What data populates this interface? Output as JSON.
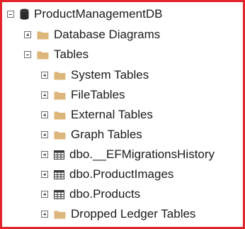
{
  "tree": {
    "root": {
      "label": "ProductManagementDB",
      "state": "expanded",
      "icon": "database-icon"
    },
    "nodes": [
      {
        "label": "Database Diagrams",
        "state": "collapsed",
        "icon": "folder-icon"
      },
      {
        "label": "Tables",
        "state": "expanded",
        "icon": "folder-icon"
      },
      {
        "label": "System Tables",
        "state": "collapsed",
        "icon": "folder-icon"
      },
      {
        "label": "FileTables",
        "state": "collapsed",
        "icon": "folder-icon"
      },
      {
        "label": "External Tables",
        "state": "collapsed",
        "icon": "folder-icon"
      },
      {
        "label": "Graph Tables",
        "state": "collapsed",
        "icon": "folder-icon"
      },
      {
        "label": "dbo.__EFMigrationsHistory",
        "state": "collapsed",
        "icon": "table-icon"
      },
      {
        "label": "dbo.ProductImages",
        "state": "collapsed",
        "icon": "table-icon"
      },
      {
        "label": "dbo.Products",
        "state": "collapsed",
        "icon": "table-icon"
      },
      {
        "label": "Dropped Ledger Tables",
        "state": "collapsed",
        "icon": "folder-icon"
      }
    ]
  },
  "colors": {
    "frame": "#e3242b",
    "folder": "#dcb67a",
    "database": "#2b2b2b",
    "table": "#3a3a3a"
  }
}
